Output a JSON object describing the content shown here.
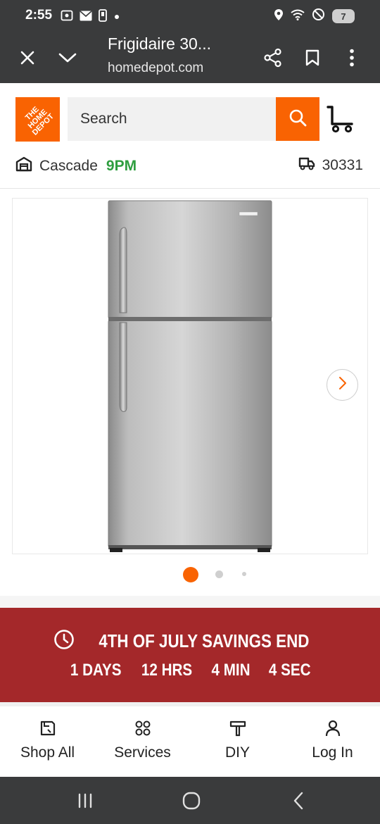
{
  "status_bar": {
    "time": "2:55",
    "battery": "7",
    "icons": [
      "screenshot-icon",
      "mail-icon",
      "phone-icon",
      "dot-icon",
      "location-icon",
      "wifi-icon",
      "dnd-icon",
      "battery-icon"
    ]
  },
  "browser": {
    "title": "Frigidaire 30...",
    "url": "homedepot.com",
    "icons": [
      "close-icon",
      "chevron-down-icon",
      "share-icon",
      "bookmark-icon",
      "more-vert-icon"
    ]
  },
  "header": {
    "logo_text": "THE\nHOME\nDEPOT",
    "search_placeholder": "Search",
    "store_name": "Cascade",
    "store_hours": "9PM",
    "zip": "30331",
    "colors": {
      "brand": "#f96302",
      "open": "#2e9e3f"
    }
  },
  "product_image": {
    "brand_label": "Frigidaire",
    "dots": [
      {
        "active": true
      },
      {
        "active": false
      },
      {
        "active": false
      }
    ]
  },
  "savings_banner": {
    "title": "4TH OF JULY SAVINGS END",
    "countdown": [
      "1 DAYS",
      "12 HRS",
      "4 MIN",
      "4 SEC"
    ],
    "color": "#a4282a"
  },
  "bottom_nav": {
    "items": [
      {
        "label": "Shop All",
        "icon": "door-icon"
      },
      {
        "label": "Services",
        "icon": "grid-icon"
      },
      {
        "label": "DIY",
        "icon": "hammer-icon"
      },
      {
        "label": "Log In",
        "icon": "person-icon"
      }
    ]
  },
  "android_nav": [
    "recents-icon",
    "home-icon",
    "back-icon"
  ]
}
